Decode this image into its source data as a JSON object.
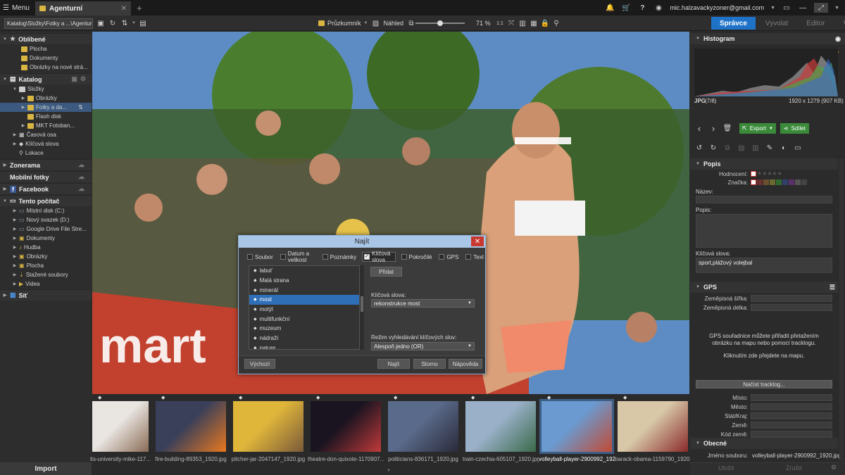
{
  "topbar": {
    "menu_label": "Menu",
    "tab_title": "Agenturní",
    "add_tab": "+",
    "account": "mic.halzavackyzoner@gmail.com"
  },
  "toolbar": {
    "path": "Katalog\\Složky\\Fotky a ...\\Agenturní",
    "explorer_label": "Průzkumník",
    "preview_label": "Náhled",
    "zoom": "71 %",
    "modes": [
      "Správce",
      "Vyvolat",
      "Editor",
      "Vytvořit"
    ],
    "active_mode": "Správce"
  },
  "sidebar": {
    "favorites_head": "Oblíbené",
    "favorites": [
      "Plocha",
      "Dokumenty",
      "Obrázky na nové strá..."
    ],
    "catalog_head": "Katalog",
    "folders_label": "Složky",
    "catalog_folders": [
      "Obrázky",
      "Fotky a da...",
      "Flash disk",
      "MKT Fotoban..."
    ],
    "catalog_other": [
      "Časová osa",
      "Klíčová slova",
      "Lokace"
    ],
    "zonerama_head": "Zonerama",
    "mobile_head": "Mobilní fotky",
    "facebook_head": "Facebook",
    "pc_head": "Tento počítač",
    "pc_items": [
      "Místní disk (C:)",
      "Nový svazek (D:)",
      "Google Drive File Stre...",
      "Dokumenty",
      "Hudba",
      "Obrázky",
      "Plocha",
      "Stažené soubory",
      "Videa"
    ],
    "network_head": "Síť",
    "import_label": "Import"
  },
  "dialog": {
    "title": "Najít",
    "tabs": [
      {
        "label": "Soubor",
        "checked": false
      },
      {
        "label": "Datum a velikost",
        "checked": false
      },
      {
        "label": "Poznámky",
        "checked": false
      },
      {
        "label": "Klíčová slova",
        "checked": true
      },
      {
        "label": "Pokročilé",
        "checked": false
      },
      {
        "label": "GPS",
        "checked": false
      },
      {
        "label": "Text",
        "checked": false
      }
    ],
    "keywords": [
      "labuť",
      "Malá strana",
      "minerál",
      "most",
      "motýl",
      "multifunkční",
      "muzeum",
      "nádraží",
      "nature"
    ],
    "selected_keyword": "most",
    "add_button": "Přidat",
    "keywords_label": "Klíčová slova:",
    "keywords_value": "rekonstrukce most",
    "mode_label": "Režim vyhledávání klíčových slov:",
    "mode_value": "Alespoň jedno (OR)",
    "default_button": "Výchozí",
    "find_button": "Najít",
    "cancel_button": "Storno",
    "help_button": "Nápověda"
  },
  "filmstrip": [
    {
      "caption": "its-university-mike-117...",
      "colors": [
        "#e9e6e2",
        "#8a6b55"
      ]
    },
    {
      "caption": "fire-building-89353_1920.jpg",
      "colors": [
        "#3a3f5a",
        "#e8781e"
      ]
    },
    {
      "caption": "pitcher-jar-2047147_1920.jpg",
      "colors": [
        "#e0b63a",
        "#7a5a3a"
      ]
    },
    {
      "caption": "theatre-don-quixote-1170907...",
      "colors": [
        "#1a1420",
        "#c03a3a"
      ]
    },
    {
      "caption": "politicians-836171_1920.jpg",
      "colors": [
        "#5a6a8a",
        "#2a2a3a"
      ]
    },
    {
      "caption": "train-czechia-605107_1920.jpg",
      "colors": [
        "#9ab0c8",
        "#3a6a4a"
      ]
    },
    {
      "caption": "volleyball-player-2900992_192...",
      "colors": [
        "#6a9ad0",
        "#c24a34"
      ]
    },
    {
      "caption": "barack-obama-1159790_1920....",
      "colors": [
        "#d8c8a8",
        "#8a2a2a"
      ]
    }
  ],
  "filmstrip_selected": "volleyball-player-2900992_192...",
  "right_panel": {
    "histogram_head": "Histogram",
    "file_type": "JPG",
    "file_index": "(7/8)",
    "file_info": "1920 x 1279 (907 KB)",
    "export_label": "Export",
    "share_label": "Sdílet",
    "description_head": "Popis",
    "rating_label": "Hodnocení:",
    "color_label": "Značka:",
    "name_label": "Název:",
    "desc_label": "Popis:",
    "keywords_label": "Klíčová slova:",
    "keywords_value": "sport,plážový volejbal",
    "gps_head": "GPS",
    "lat_label": "Zeměpisná šířka:",
    "lon_label": "Zeměpisná délka:",
    "gps_hint": "GPS souřadnice můžete přiřadit přetažením obrázku na mapu nebo pomocí tracklogu.",
    "map_hint": "Kliknutím zde přejdete na mapu.",
    "tracklog_button": "Načíst tracklog...",
    "place_labels": [
      "Místo:",
      "Město:",
      "Stát/Kraj:",
      "Země:",
      "Kód země:"
    ],
    "general_head": "Obecné",
    "filename_label": "Jméno souboru:",
    "filename_value": "volleyball-player-2900992_1920.jpg",
    "save_button": "Uložit",
    "close_button": "Zrušit"
  },
  "colors": {
    "accent": "#1e73c8",
    "selection": "#2f6fb8",
    "export_green": "#3a8a3a",
    "close_red": "#c9382e"
  }
}
